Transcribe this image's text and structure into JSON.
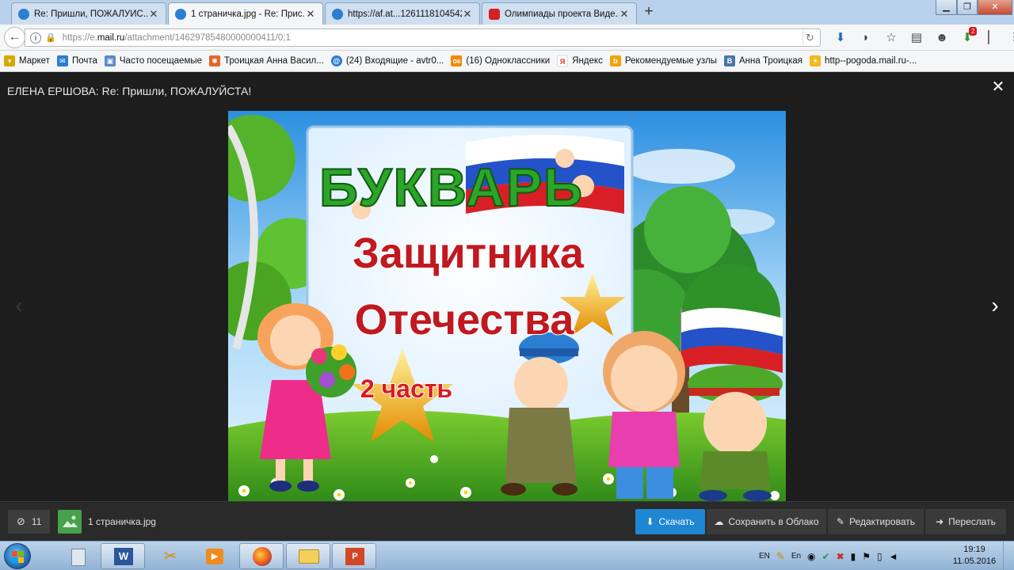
{
  "browser": {
    "tabs": [
      {
        "title": "Re: Пришли, ПОЖАЛУЙС...",
        "active": false,
        "icon_color": "#2b7ed1"
      },
      {
        "title": "1 страничка.jpg - Re: Прис...",
        "active": true,
        "icon_color": "#2b7ed1"
      },
      {
        "title": "https://af.at...1261118104542",
        "active": false,
        "icon_color": "#2b7ed1"
      },
      {
        "title": "Олимпиады проекта Виде...",
        "active": false,
        "icon_color": "#d42020"
      }
    ],
    "url": {
      "prefix": "https://e.",
      "domain": "mail.ru",
      "path": "/attachment/14629785480000000411/0;1"
    },
    "downloads_badge": "2",
    "bookmarks": [
      {
        "label": "Маркет",
        "icon_color": "#d8a800"
      },
      {
        "label": "Почта",
        "icon_color": "#2b7ed1"
      },
      {
        "label": "Часто посещаемые",
        "icon_color": "#5a8bc6"
      },
      {
        "label": "Троицкая Анна Васил...",
        "icon_color": "#e2662a"
      },
      {
        "label": "(24) Входящие - avtr0...",
        "icon_color": "#2b7ed1"
      },
      {
        "label": "(16) Одноклассники",
        "icon_color": "#f08a00"
      },
      {
        "label": "Яндекс",
        "icon_color": "#e5332a"
      },
      {
        "label": "Рекомендуемые узлы",
        "icon_color": "#f0a30a"
      },
      {
        "label": "Анна Троицкая",
        "icon_color": "#4a76a8"
      },
      {
        "label": "http--pogoda.mail.ru-...",
        "icon_color": "#f2b81d"
      }
    ]
  },
  "viewer": {
    "title": "ЕЛЕНА ЕРШОВА: Re: Пришли, ПОЖАЛУЙСТА!",
    "image_text": {
      "title": "БУКВАРЬ",
      "line1": "Защитника",
      "line2": "Отечества",
      "part": "2 часть"
    },
    "footer": {
      "attachments_count": "11",
      "filename": "1 страничка.jpg",
      "download": "Скачать",
      "save_cloud": "Сохранить в Облако",
      "edit": "Редактировать",
      "forward": "Переслать"
    }
  },
  "taskbar": {
    "language": "EN",
    "tray_lang": "En",
    "time": "19:19",
    "date": "11.05.2016"
  },
  "colors": {
    "download_button": "#1f86d4",
    "viewer_bg": "#1d1d1d",
    "footer_bg": "#2a2a2a"
  }
}
